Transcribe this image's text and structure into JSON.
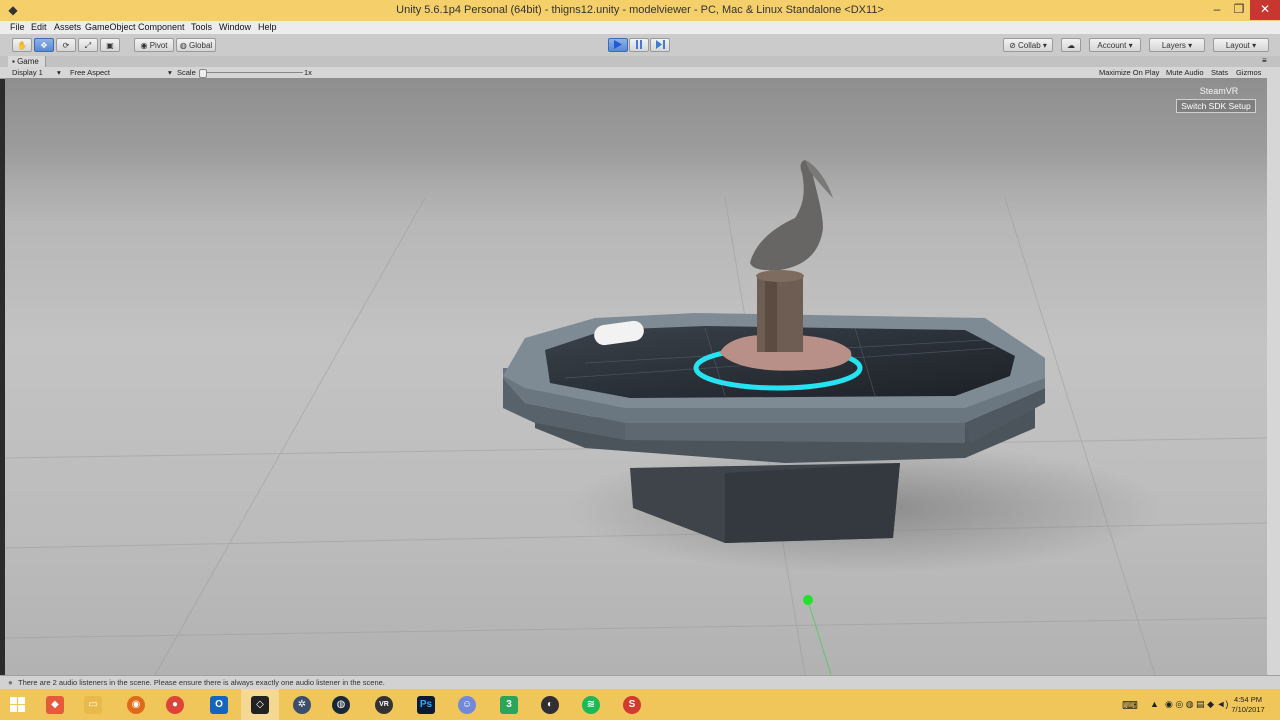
{
  "window": {
    "title": "Unity 5.6.1p4 Personal (64bit) - thigns12.unity - modelviewer - PC, Mac & Linux Standalone <DX11>",
    "controls": {
      "minimize": "–",
      "maximize": "❐",
      "close": "✕"
    }
  },
  "menu": [
    "File",
    "Edit",
    "Assets",
    "GameObject",
    "Component",
    "Tools",
    "Window",
    "Help"
  ],
  "toolbar": {
    "pivot": "Pivot",
    "global": "Global",
    "collab": "Collab",
    "account": "Account",
    "layers": "Layers",
    "layout": "Layout"
  },
  "game_view": {
    "tab": "Game",
    "display": "Display 1",
    "aspect": "Free Aspect",
    "scale_label": "Scale",
    "scale_value": "1x",
    "options": [
      "Maximize On Play",
      "Mute Audio",
      "Stats",
      "Gizmos"
    ]
  },
  "steamvr": {
    "label": "SteamVR",
    "button": "Switch SDK Setup"
  },
  "status_message": "There are 2 audio listeners in the scene. Please ensure there is always exactly one audio listener in the scene.",
  "taskbar": {
    "apps": [
      "Windows Explorer",
      "Firefox",
      "Chrome",
      "Outlook",
      "Unity",
      "Steam VR",
      "Steam",
      "Oculus",
      "Photoshop",
      "Discord",
      "Notepad++",
      "OBS",
      "Spotify",
      "Substance"
    ],
    "photoshop_label": "Ps",
    "time": "4:54 PM",
    "date": "7/10/2017"
  },
  "colors": {
    "titlebar": "#f4cf6a",
    "taskbar": "#f0c55a",
    "play_active": "#5a88d6",
    "teleport_ring": "#27e2f0"
  }
}
